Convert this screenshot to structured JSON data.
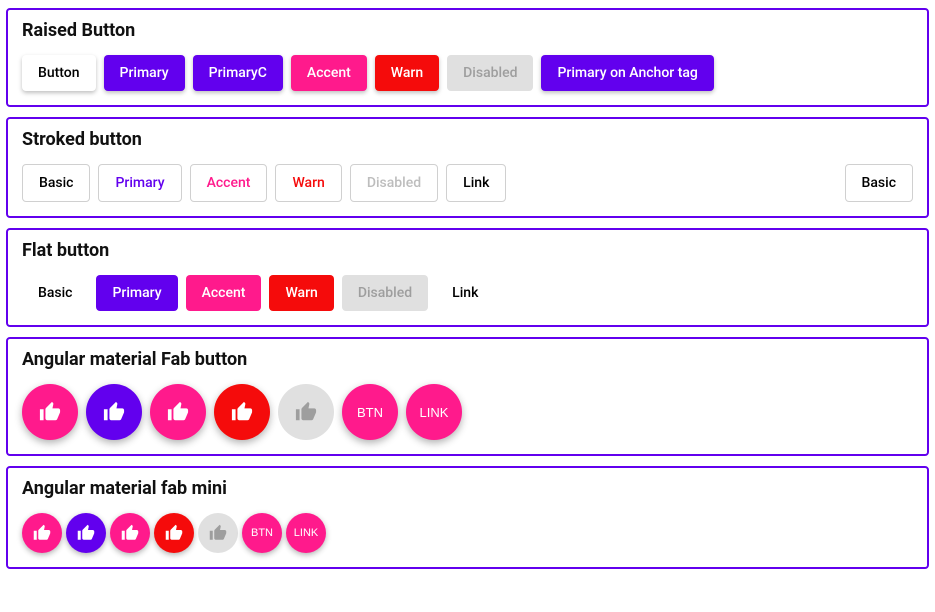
{
  "raised": {
    "title": "Raised Button",
    "buttons": {
      "basic": "Button",
      "primary": "Primary",
      "primaryc": "PrimaryC",
      "accent": "Accent",
      "warn": "Warn",
      "disabled": "Disabled",
      "anchor": "Primary on Anchor tag"
    }
  },
  "stroked": {
    "title": "Stroked button",
    "buttons": {
      "basic": "Basic",
      "primary": "Primary",
      "accent": "Accent",
      "warn": "Warn",
      "disabled": "Disabled",
      "link": "Link",
      "basic_right": "Basic"
    }
  },
  "flat": {
    "title": "Flat button",
    "buttons": {
      "basic": "Basic",
      "primary": "Primary",
      "accent": "Accent",
      "warn": "Warn",
      "disabled": "Disabled",
      "link": "Link"
    }
  },
  "fab": {
    "title": "Angular material Fab button",
    "btn": "BTN",
    "link": "LINK"
  },
  "fab_mini": {
    "title": "Angular material fab mini",
    "btn": "BTN",
    "link": "LINK"
  },
  "icons": {
    "thumb_up": "thumb-up-icon"
  },
  "colors": {
    "primary": "#6200ee",
    "accent": "#ff1a8c",
    "warn": "#f50b0b",
    "disabled_bg": "#e0e0e0",
    "disabled_fg": "#9e9e9e",
    "border": "#6200ee"
  }
}
